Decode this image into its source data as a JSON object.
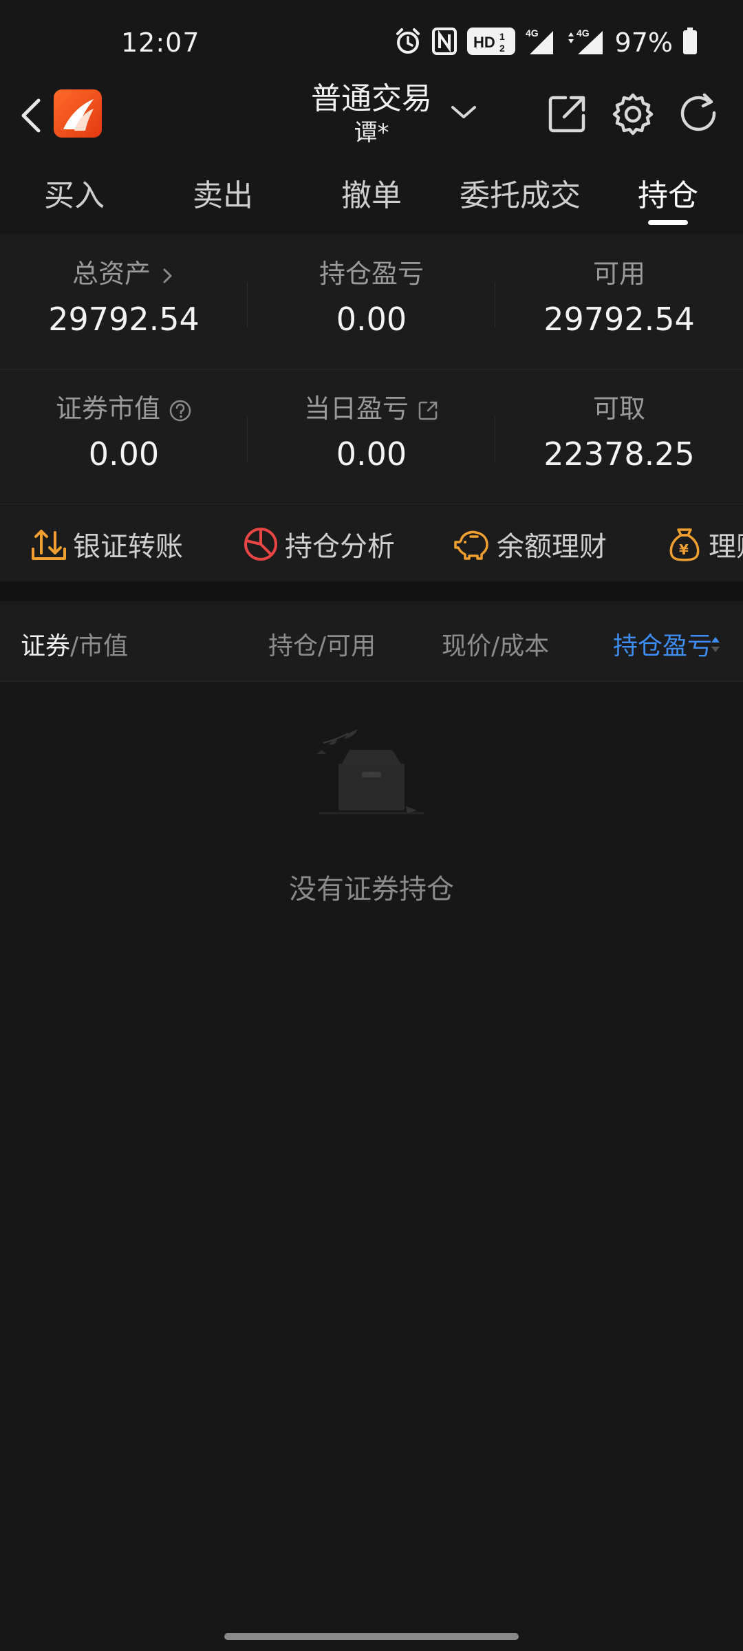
{
  "status_bar": {
    "time": "12:07",
    "battery": "97%",
    "icons": [
      "alarm-icon",
      "nfc-icon",
      "hd-icon",
      "signal-4g-icon",
      "signal-4g-icon",
      "battery-icon"
    ]
  },
  "header": {
    "title": "普通交易",
    "account": "谭*",
    "icons": [
      "back-icon",
      "app-logo",
      "chevron-down-icon",
      "share-icon",
      "settings-icon",
      "refresh-icon"
    ]
  },
  "tabs": [
    {
      "label": "买入",
      "active": false
    },
    {
      "label": "卖出",
      "active": false
    },
    {
      "label": "撤单",
      "active": false
    },
    {
      "label": "委托成交",
      "active": false
    },
    {
      "label": "持仓",
      "active": true
    }
  ],
  "summary": {
    "total_assets_label": "总资产",
    "total_assets": "29792.54",
    "position_pl_label": "持仓盈亏",
    "position_pl": "0.00",
    "available_label": "可用",
    "available": "29792.54",
    "market_value_label": "证券市值",
    "market_value": "0.00",
    "daily_pl_label": "当日盈亏",
    "daily_pl": "0.00",
    "withdrawable_label": "可取",
    "withdrawable": "22378.25"
  },
  "actions": [
    {
      "label": "银证转账",
      "icon": "transfer-icon",
      "color": "#f0a030"
    },
    {
      "label": "持仓分析",
      "icon": "pie-chart-icon",
      "color": "#e84545"
    },
    {
      "label": "余额理财",
      "icon": "piggy-bank-icon",
      "color": "#f0a030"
    },
    {
      "label": "理财",
      "icon": "money-bag-icon",
      "color": "#f0a030"
    }
  ],
  "table_header": {
    "col1_primary": "证券",
    "col1_secondary": "/市值",
    "col2": "持仓/可用",
    "col3": "现价/成本",
    "col4": "持仓盈亏"
  },
  "empty_state": {
    "message": "没有证券持仓",
    "icon": "empty-box-icon"
  },
  "colors": {
    "background": "#171717",
    "panel": "#1c1c1c",
    "accent_blue": "#3d8df5",
    "accent_orange": "#f0a030",
    "accent_red": "#e84545",
    "logo_orange": "#ff5a1f"
  }
}
